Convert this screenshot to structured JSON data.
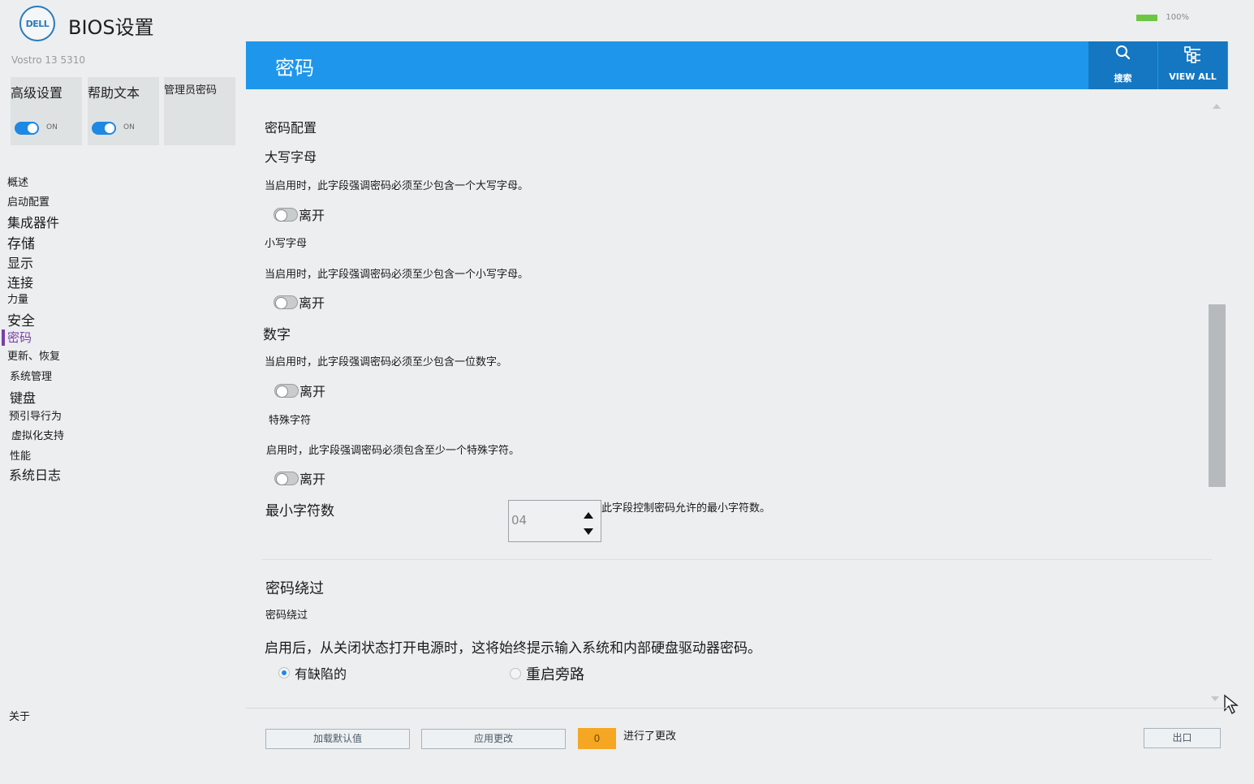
{
  "header": {
    "logo": "DELL",
    "title": "BIOS设置",
    "battery_percent": "100%",
    "battery_level": 1.0
  },
  "sidebar": {
    "model": "Vostro 13 5310",
    "tiles": [
      {
        "label": "高级设置",
        "state": "ON"
      },
      {
        "label": "帮助文本",
        "state": "ON"
      },
      {
        "label": "管理员密码"
      }
    ],
    "nav": [
      {
        "label": "概述"
      },
      {
        "label": "启动配置"
      },
      {
        "label": "集成器件"
      },
      {
        "label": "存储"
      },
      {
        "label": "显示"
      },
      {
        "label": "连接"
      },
      {
        "label": "力量"
      },
      {
        "label": "安全"
      },
      {
        "label": "密码",
        "active": true
      },
      {
        "label": "更新、恢复"
      },
      {
        "label": "系统管理"
      },
      {
        "label": "键盘"
      },
      {
        "label": "预引导行为"
      },
      {
        "label": "虚拟化支持"
      },
      {
        "label": "性能"
      },
      {
        "label": "系统日志"
      }
    ],
    "about": "关于"
  },
  "main": {
    "title": "密码",
    "search_label": "搜索",
    "search_icon": "search-icon",
    "viewall_label": "VIEW ALL",
    "viewall_icon": "settings-sliders-icon",
    "section_password_config": "密码配置",
    "uppercase": {
      "title": "大写字母",
      "desc": "当启用时，此字段强调密码必须至少包含一个大写字母。",
      "toggle_label": "离开"
    },
    "lowercase": {
      "title": "小写字母",
      "desc": "当启用时，此字段强调密码必须至少包含一个小写字母。",
      "toggle_label": "离开"
    },
    "digit": {
      "title": "数字",
      "desc": "当启用时，此字段强调密码必须至少包含一位数字。",
      "toggle_label": "离开"
    },
    "special": {
      "title": "特殊字符",
      "desc": "启用时，此字段强调密码必须包含至少一个特殊字符。",
      "toggle_label": "离开"
    },
    "min_chars": {
      "title": "最小字符数",
      "value": "04",
      "desc": "此字段控制密码允许的最小字符数。"
    },
    "bypass": {
      "section": "密码绕过",
      "title": "密码绕过",
      "desc": "启用后，从关闭状态打开电源时，这将始终提示输入系统和内部硬盘驱动器密码。",
      "options": [
        {
          "label": "有缺陷的",
          "checked": true
        },
        {
          "label": "重启旁路",
          "checked": false
        }
      ]
    }
  },
  "footer": {
    "load_defaults": "加载默认值",
    "apply_changes": "应用更改",
    "change_count": "0",
    "changes_label": "进行了更改",
    "exit": "出口"
  },
  "colors": {
    "header_blue": "#1e96ec",
    "header_btn_blue": "#1577c2",
    "active_nav": "#7b3fa8",
    "toggle_on": "#1e88e5",
    "badge_orange": "#f5a623",
    "battery_green": "#6cc644"
  }
}
